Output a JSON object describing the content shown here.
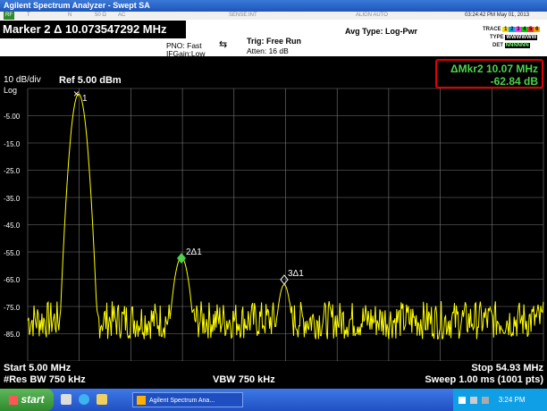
{
  "window": {
    "title": "Agilent Spectrum Analyzer - Swept SA"
  },
  "menu": {
    "items": [
      "T",
      "N",
      "50 Ω",
      "AC",
      "SENSE:INT",
      "ALIGN AUTO"
    ]
  },
  "marker": {
    "header": "Marker 2 Δ 10.073547292 MHz"
  },
  "info": {
    "pno": "PNO: Fast",
    "ifgain": "IFGain:Low",
    "trig": "Trig: Free Run",
    "atten": "Atten: 16 dB",
    "avg": "Avg Type: Log-Pwr",
    "datetime": "03:24:42 PM May 01, 2013"
  },
  "trace_panel": {
    "trace_label": "TRACE",
    "trace_vals": [
      "1",
      "2",
      "3",
      "4",
      "5",
      "6"
    ],
    "type_label": "TYPE",
    "type_val": "WWWWWW",
    "det_label": "DET",
    "det_val": "NNNNNN"
  },
  "plot": {
    "scale": "10 dB/div",
    "log": "Log",
    "ref": "Ref 5.00 dBm",
    "y_ticks": [
      "-5.00",
      "-15.0",
      "-25.0",
      "-35.0",
      "-45.0",
      "-55.0",
      "-65.0",
      "-75.0",
      "-85.0"
    ],
    "marker_readout": {
      "line1": "ΔMkr2 10.07 MHz",
      "line2": "-62.84 dB"
    },
    "marker_labels": [
      "1",
      "2Δ1",
      "3Δ1"
    ]
  },
  "bottom": {
    "start": "Start 5.00 MHz",
    "rbw": "#Res BW 750 kHz",
    "vbw": "VBW 750 kHz",
    "stop": "Stop 54.93 MHz",
    "sweep": "Sweep  1.00 ms (1001 pts)"
  },
  "taskbar": {
    "start": "start",
    "app": "Agilent Spectrum Ana...",
    "clock": "3:24 PM"
  },
  "colors": {
    "trace": "#ffff00",
    "marker_readout": "#4bd34b",
    "accent": "#e00000"
  }
}
